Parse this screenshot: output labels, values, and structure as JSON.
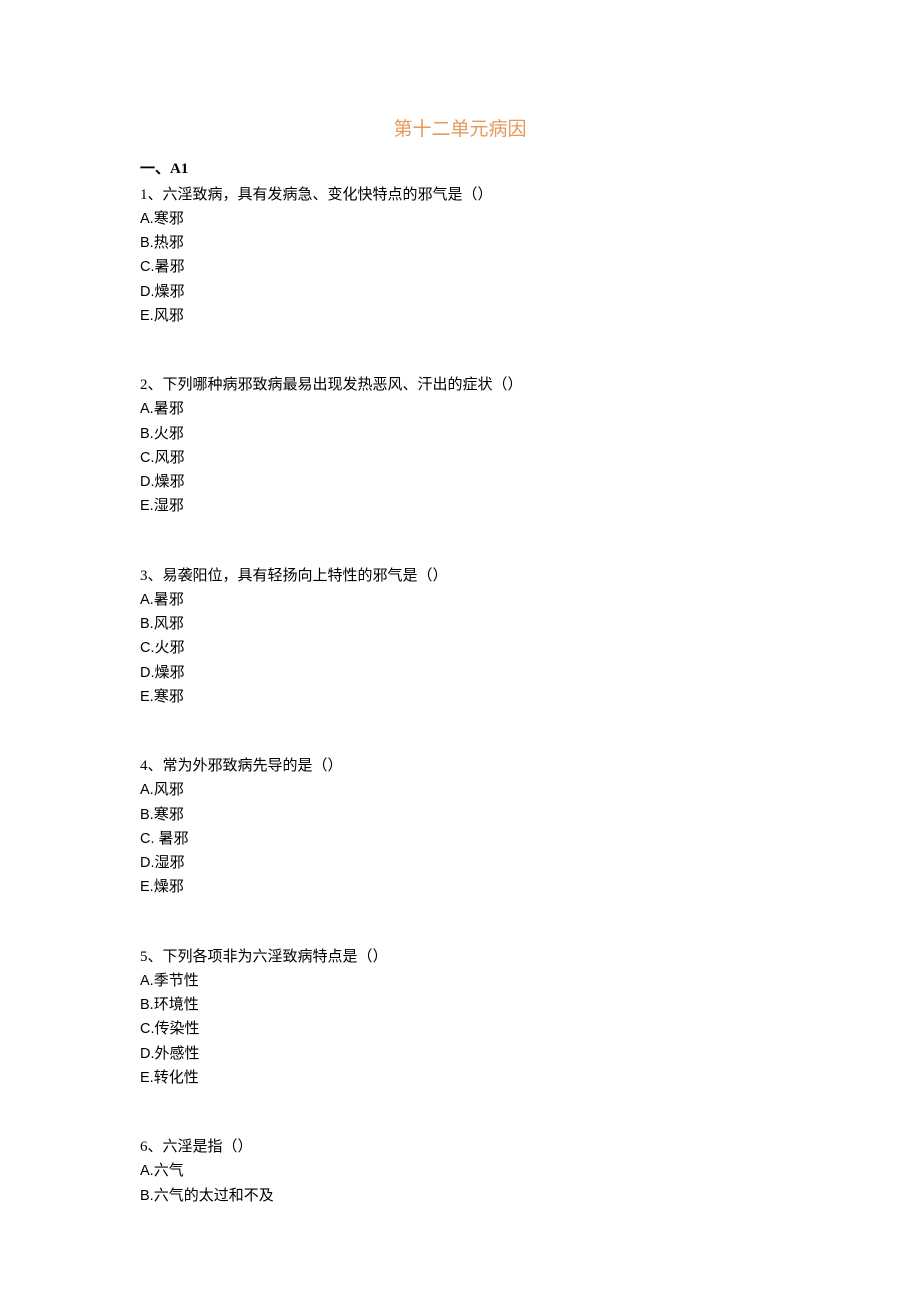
{
  "title": "第十二单元病因",
  "section_header": "一、A1",
  "questions": [
    {
      "text": "1、六淫致病，具有发病急、变化快特点的邪气是（）",
      "options": [
        "A.寒邪",
        "B.热邪",
        "C.暑邪",
        "D.燥邪",
        "E.风邪"
      ]
    },
    {
      "text": "2、下列哪种病邪致病最易出现发热恶风、汗出的症状（）",
      "options": [
        "A.暑邪",
        "B.火邪",
        "C.风邪",
        "D.燥邪",
        "E.湿邪"
      ]
    },
    {
      "text": "3、易袭阳位，具有轻扬向上特性的邪气是（）",
      "options": [
        "A.暑邪",
        "B.风邪",
        "C.火邪",
        "D.燥邪",
        "E.寒邪"
      ]
    },
    {
      "text": "4、常为外邪致病先导的是（）",
      "options": [
        "A.风邪",
        "B.寒邪",
        "C. 暑邪",
        "D.湿邪",
        "E.燥邪"
      ]
    },
    {
      "text": "5、下列各项非为六淫致病特点是（）",
      "options": [
        "A.季节性",
        "B.环境性",
        "C.传染性",
        "D.外感性",
        "E.转化性"
      ]
    },
    {
      "text": "6、六淫是指（）",
      "options": [
        "A.六气",
        "B.六气的太过和不及"
      ]
    }
  ]
}
